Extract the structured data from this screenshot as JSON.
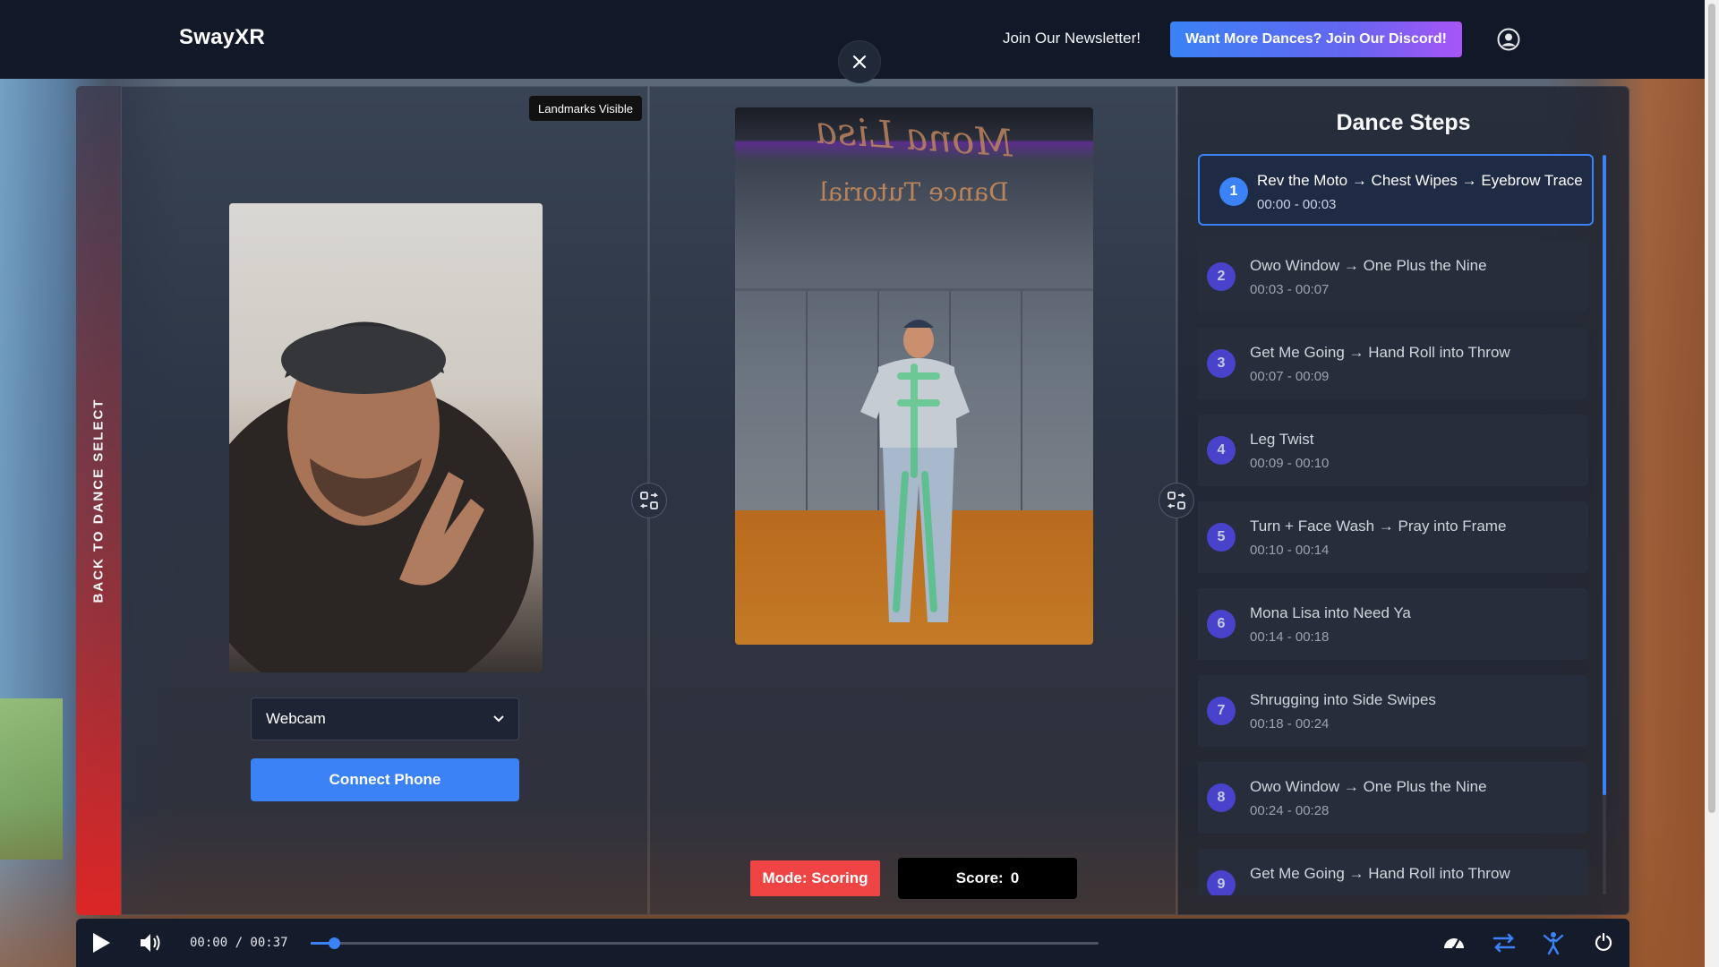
{
  "header": {
    "brand": "SwayXR",
    "newsletter_link": "Join Our Newsletter!",
    "discord_button": "Want More Dances? Join Our Discord!"
  },
  "back_bar": {
    "label": "BACK TO DANCE SELECT"
  },
  "webcam_panel": {
    "landmarks_badge": "Landmarks Visible",
    "source_select": {
      "selected": "Webcam"
    },
    "connect_button": "Connect Phone"
  },
  "video_panel": {
    "video_overlay_title": "Dance Tutorial",
    "mode_badge": "Mode: Scoring",
    "score_label": "Score:",
    "score_value": "0"
  },
  "steps_panel": {
    "title": "Dance Steps",
    "steps": [
      {
        "number": "1",
        "label": "Rev the Moto → Chest Wipes → Eyebrow Trace",
        "time": "00:00 - 00:03",
        "active": true
      },
      {
        "number": "2",
        "label": "Owo Window → One Plus the Nine",
        "time": "00:03 - 00:07",
        "active": false
      },
      {
        "number": "3",
        "label": "Get Me Going → Hand Roll into Throw",
        "time": "00:07 - 00:09",
        "active": false
      },
      {
        "number": "4",
        "label": "Leg Twist",
        "time": "00:09 - 00:10",
        "active": false
      },
      {
        "number": "5",
        "label": "Turn + Face Wash → Pray into Frame",
        "time": "00:10 - 00:14",
        "active": false
      },
      {
        "number": "6",
        "label": "Mona Lisa into Need Ya",
        "time": "00:14 - 00:18",
        "active": false
      },
      {
        "number": "7",
        "label": "Shrugging into Side Swipes",
        "time": "00:18 - 00:24",
        "active": false
      },
      {
        "number": "8",
        "label": "Owo Window → One Plus the Nine",
        "time": "00:24 - 00:28",
        "active": false
      },
      {
        "number": "9",
        "label": "Get Me Going → Hand Roll into Throw",
        "time": "",
        "active": false
      }
    ]
  },
  "player": {
    "time_readout": "00:00 / 00:37",
    "progress_fraction": 0.03
  },
  "colors": {
    "accent": "#3b82f6",
    "mode_badge": "#ef4444",
    "navbar": "#111827"
  },
  "icons": {
    "close": "close-icon",
    "user": "user-circle-icon",
    "swap": "swap-icon",
    "play": "play-icon",
    "volume": "volume-icon",
    "speed": "speedometer-icon",
    "loop": "loop-icon",
    "dancer": "dancer-icon",
    "reset": "reset-icon"
  }
}
